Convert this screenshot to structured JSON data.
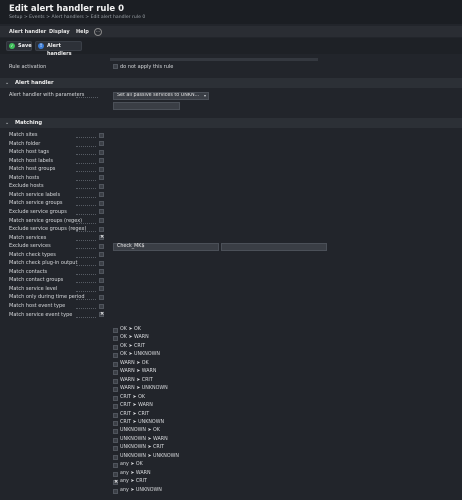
{
  "header": {
    "title": "Edit alert handler rule 0",
    "breadcrumb": "Setup > Events > Alert handlers > Edit alert handler rule 0"
  },
  "menu": {
    "items": [
      "Alert handler",
      "Display",
      "Help"
    ]
  },
  "actions": {
    "save_label": "Save",
    "alert_handlers_label": "Alert handlers"
  },
  "rule_activation": {
    "label": "Rule activation",
    "checkbox_label": "do not apply this rule"
  },
  "alert_handler_section": {
    "title": "Alert handler",
    "field_label": "Alert handler with parameters",
    "selected_value": "Set all passive services to UNKN..."
  },
  "matching_section": {
    "title": "Matching",
    "conditions": [
      {
        "label": "Match sites",
        "checked": false
      },
      {
        "label": "Match folder",
        "checked": false
      },
      {
        "label": "Match host tags",
        "checked": false
      },
      {
        "label": "Match host labels",
        "checked": false
      },
      {
        "label": "Match host groups",
        "checked": false
      },
      {
        "label": "Match hosts",
        "checked": false
      },
      {
        "label": "Exclude hosts",
        "checked": false
      },
      {
        "label": "Match service labels",
        "checked": false
      },
      {
        "label": "Match service groups",
        "checked": false
      },
      {
        "label": "Exclude service groups",
        "checked": false
      },
      {
        "label": "Match service groups (regex)",
        "checked": false
      },
      {
        "label": "Exclude service groups (regex)",
        "checked": false
      },
      {
        "label": "Match services",
        "checked": true
      },
      {
        "label": "Exclude services",
        "checked": false
      },
      {
        "label": "Match check types",
        "checked": false
      },
      {
        "label": "Match check plug-in output",
        "checked": false
      },
      {
        "label": "Match contacts",
        "checked": false
      },
      {
        "label": "Match contact groups",
        "checked": false
      },
      {
        "label": "Match service level",
        "checked": false
      },
      {
        "label": "Match only during time period",
        "checked": false
      },
      {
        "label": "Match host event type",
        "checked": false
      },
      {
        "label": "Match service event type",
        "checked": true
      }
    ],
    "match_services_value": "Check_MK$",
    "service_event_types": [
      {
        "label": "OK ➤ OK",
        "checked": false
      },
      {
        "label": "OK ➤ WARN",
        "checked": false
      },
      {
        "label": "OK ➤ CRIT",
        "checked": false
      },
      {
        "label": "OK ➤ UNKNOWN",
        "checked": false
      },
      {
        "label": "WARN ➤ OK",
        "checked": false
      },
      {
        "label": "WARN ➤ WARN",
        "checked": false
      },
      {
        "label": "WARN ➤ CRIT",
        "checked": false
      },
      {
        "label": "WARN ➤ UNKNOWN",
        "checked": false
      },
      {
        "label": "CRIT ➤ OK",
        "checked": false
      },
      {
        "label": "CRIT ➤ WARN",
        "checked": false
      },
      {
        "label": "CRIT ➤ CRIT",
        "checked": false
      },
      {
        "label": "CRIT ➤ UNKNOWN",
        "checked": false
      },
      {
        "label": "UNKNOWN ➤ OK",
        "checked": false
      },
      {
        "label": "UNKNOWN ➤ WARN",
        "checked": false
      },
      {
        "label": "UNKNOWN ➤ CRIT",
        "checked": false
      },
      {
        "label": "UNKNOWN ➤ UNKNOWN",
        "checked": false
      },
      {
        "label": "any ➤ OK",
        "checked": false
      },
      {
        "label": "any ➤ WARN",
        "checked": false
      },
      {
        "label": "any ➤ CRIT",
        "checked": true
      },
      {
        "label": "any ➤ UNKNOWN",
        "checked": false
      }
    ]
  },
  "colors": {
    "background": "#22252b",
    "save_icon": "#3fbf5a",
    "alert_handlers_icon": "#3a7bd5"
  }
}
